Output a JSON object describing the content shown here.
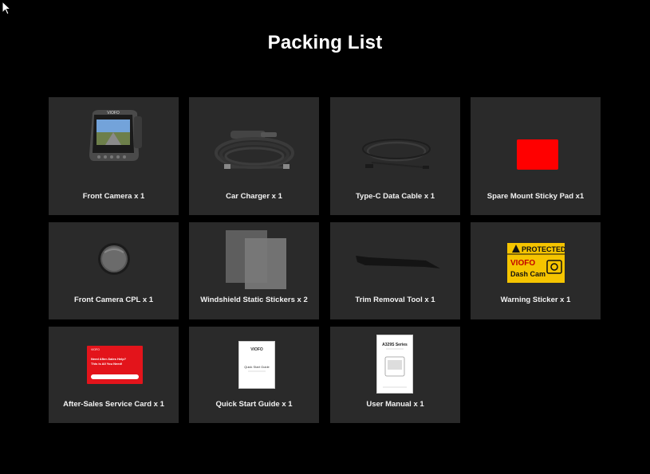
{
  "page": {
    "title": "Packing List"
  },
  "items": [
    {
      "label": "Front Camera x 1",
      "icon": "dash-camera-icon",
      "brand": "VIOFO"
    },
    {
      "label": "Car Charger x 1",
      "icon": "car-charger-icon"
    },
    {
      "label": "Type-C Data Cable x 1",
      "icon": "data-cable-icon"
    },
    {
      "label": "Spare Mount Sticky Pad x1",
      "icon": "sticky-pad-icon",
      "color": "#ff0000"
    },
    {
      "label": "Front Camera CPL x 1",
      "icon": "cpl-filter-icon"
    },
    {
      "label": "Windshield Static Stickers x 2",
      "icon": "static-stickers-icon"
    },
    {
      "label": "Trim Removal Tool x 1",
      "icon": "trim-tool-icon"
    },
    {
      "label": "Warning Sticker x 1",
      "icon": "warning-sticker-icon",
      "sticker": {
        "line1": "PROTECTED",
        "line2": "VIOFO",
        "line3": "Dash Cam"
      },
      "color": "#f5c400"
    },
    {
      "label": "After-Sales Service Card x 1",
      "icon": "service-card-icon",
      "card": {
        "brand": "VIOFO",
        "line1": "Need After-Sales Help?",
        "line2": "This is All You Need!"
      },
      "color": "#e3141b"
    },
    {
      "label": "Quick Start Guide x 1",
      "icon": "quick-start-guide-icon",
      "guide": {
        "brand": "VIOFO",
        "title": "Quick Start Guide"
      }
    },
    {
      "label": "User Manual x 1",
      "icon": "user-manual-icon",
      "manual": {
        "title": "A329S Series"
      }
    }
  ]
}
